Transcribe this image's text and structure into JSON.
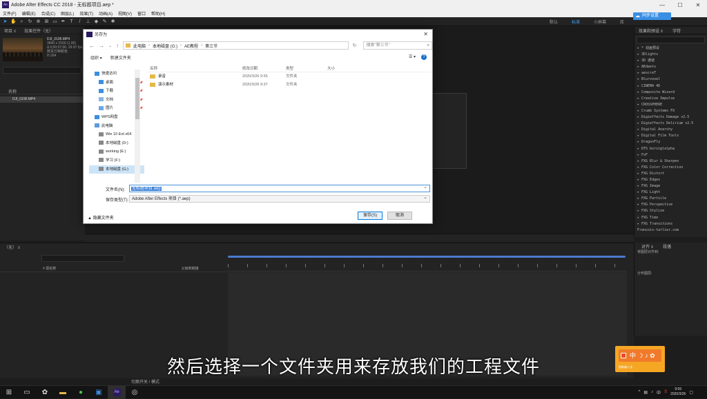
{
  "app": {
    "title": "Adobe After Effects CC 2018 - 无标题项目.aep *",
    "window_controls": [
      "—",
      "☐",
      "✕"
    ]
  },
  "menu": [
    "文件(F)",
    "编辑(E)",
    "合成(C)",
    "图层(L)",
    "效果(T)",
    "动画(A)",
    "视图(V)",
    "窗口",
    "帮助(H)"
  ],
  "workspaces": [
    {
      "label": "默认",
      "active": false
    },
    {
      "label": "标准",
      "active": true
    },
    {
      "label": "小屏幕",
      "active": false
    },
    {
      "label": "库",
      "active": false
    }
  ],
  "sync_button": "同步设置",
  "project_panel": {
    "tabs": [
      "项目 ≡",
      "效果控件（无）"
    ],
    "file": {
      "name": "DJI_0195.MP4",
      "info": [
        "3840 x 2160 (1.00)",
        "Δ 0;00;07;06, 29.97 fps",
        "数百万种颜色",
        "H.264"
      ]
    },
    "column_name": "名称",
    "item": "DJI_0195.MP4"
  },
  "effects_panel": {
    "tabs": [
      "效果和预设 ≡",
      "字符"
    ],
    "items": [
      "▸ * 动画预设",
      "▸ 3Dlights",
      "▸ 3D 通道",
      "▸ AEdeets",
      "▸ aescreT",
      "▸ Blurvoxel",
      "▸ CINEMA 4D",
      "▸ Composite Wizard",
      "▸ Creative Impulse",
      "▸ CROSSPHERE",
      "▸ Crumb Systems FX",
      "▸ Digieffects Damage v2.5",
      "▸ Digieffects Delirium v2.5",
      "▸ Digital Anarchy",
      "▸ Digital Film Tools",
      "▸ DragonFly",
      "▸ DTS boringlalpha",
      "▸ FxF",
      "▸ FXG Blur & Sharpen",
      "▸ FXG Color Correction",
      "▸ FXG Distort",
      "▸ FXG Edges",
      "▸ FXG Image",
      "▸ FXG Light",
      "▸ FXG Particle",
      "▸ FXG Perspective",
      "▸ FXG Stylize",
      "▸ FXG Time",
      "▸ FXG Transitions",
      "Francois-tarlier.com"
    ]
  },
  "align_panel": {
    "tabs": [
      "对齐 ≡",
      "段落"
    ],
    "label": "将图层对齐到:",
    "dist": "分布图层:"
  },
  "timeline": {
    "tab": "（无） ≡",
    "header": "# 源名称",
    "header2": "父级和链接",
    "footer": "切换开关 / 模式"
  },
  "dialog": {
    "title": "另存为",
    "breadcrumb": [
      "此电脑",
      "本地磁盘 (G:)",
      "AE教程",
      "第三节"
    ],
    "search_placeholder": "搜索\"第三节\"",
    "organize": "组织 ▾",
    "new_folder": "新建文件夹",
    "sidebar": [
      {
        "label": "快速访问",
        "color": "#3b8ee0",
        "pin": false,
        "indent": 0
      },
      {
        "label": "桌面",
        "color": "#3b8ee0",
        "pin": true,
        "indent": 1
      },
      {
        "label": "下载",
        "color": "#3b8ee0",
        "pin": true,
        "indent": 1
      },
      {
        "label": "文档",
        "color": "#8ab4e0",
        "pin": true,
        "indent": 1
      },
      {
        "label": "图片",
        "color": "#6aa8e8",
        "pin": true,
        "indent": 1
      },
      {
        "label": "WPS网盘",
        "color": "#3b8ee0",
        "pin": false,
        "indent": 0
      },
      {
        "label": "此电脑",
        "color": "#5b9ad8",
        "pin": false,
        "indent": 0
      },
      {
        "label": "Win 10 Ent x64",
        "color": "#888",
        "pin": false,
        "indent": 1
      },
      {
        "label": "本地磁盘 (D:)",
        "color": "#888",
        "pin": false,
        "indent": 1
      },
      {
        "label": "working (E:)",
        "color": "#888",
        "pin": false,
        "indent": 1
      },
      {
        "label": "学习 (F:)",
        "color": "#888",
        "pin": false,
        "indent": 1
      },
      {
        "label": "本地磁盘 (G:)",
        "color": "#888",
        "pin": false,
        "indent": 1
      }
    ],
    "columns": [
      "名称",
      "修改日期",
      "类型",
      "大小"
    ],
    "files": [
      {
        "name": "录音",
        "date": "2020/3/26 9:55",
        "type": "文件夹"
      },
      {
        "name": "演示素材",
        "date": "2020/3/26 9:37",
        "type": "文件夹"
      }
    ],
    "filename_label": "文件名(N):",
    "filename_value": "无标题项目.aep",
    "filetype_label": "保存类型(T):",
    "filetype_value": "Adobe After Effects 项目 (*.aep)",
    "hide_folders": "▲ 隐藏文件夹",
    "save": "保存(S)",
    "cancel": "取消"
  },
  "subtitle": "然后选择一个文件夹用来存放我们的工程文件",
  "ime": {
    "label": "中",
    "sub": "搜狗输入法"
  },
  "taskbar": {
    "time": "9:59",
    "date": "2020/3/26",
    "tray_lang": "中"
  }
}
